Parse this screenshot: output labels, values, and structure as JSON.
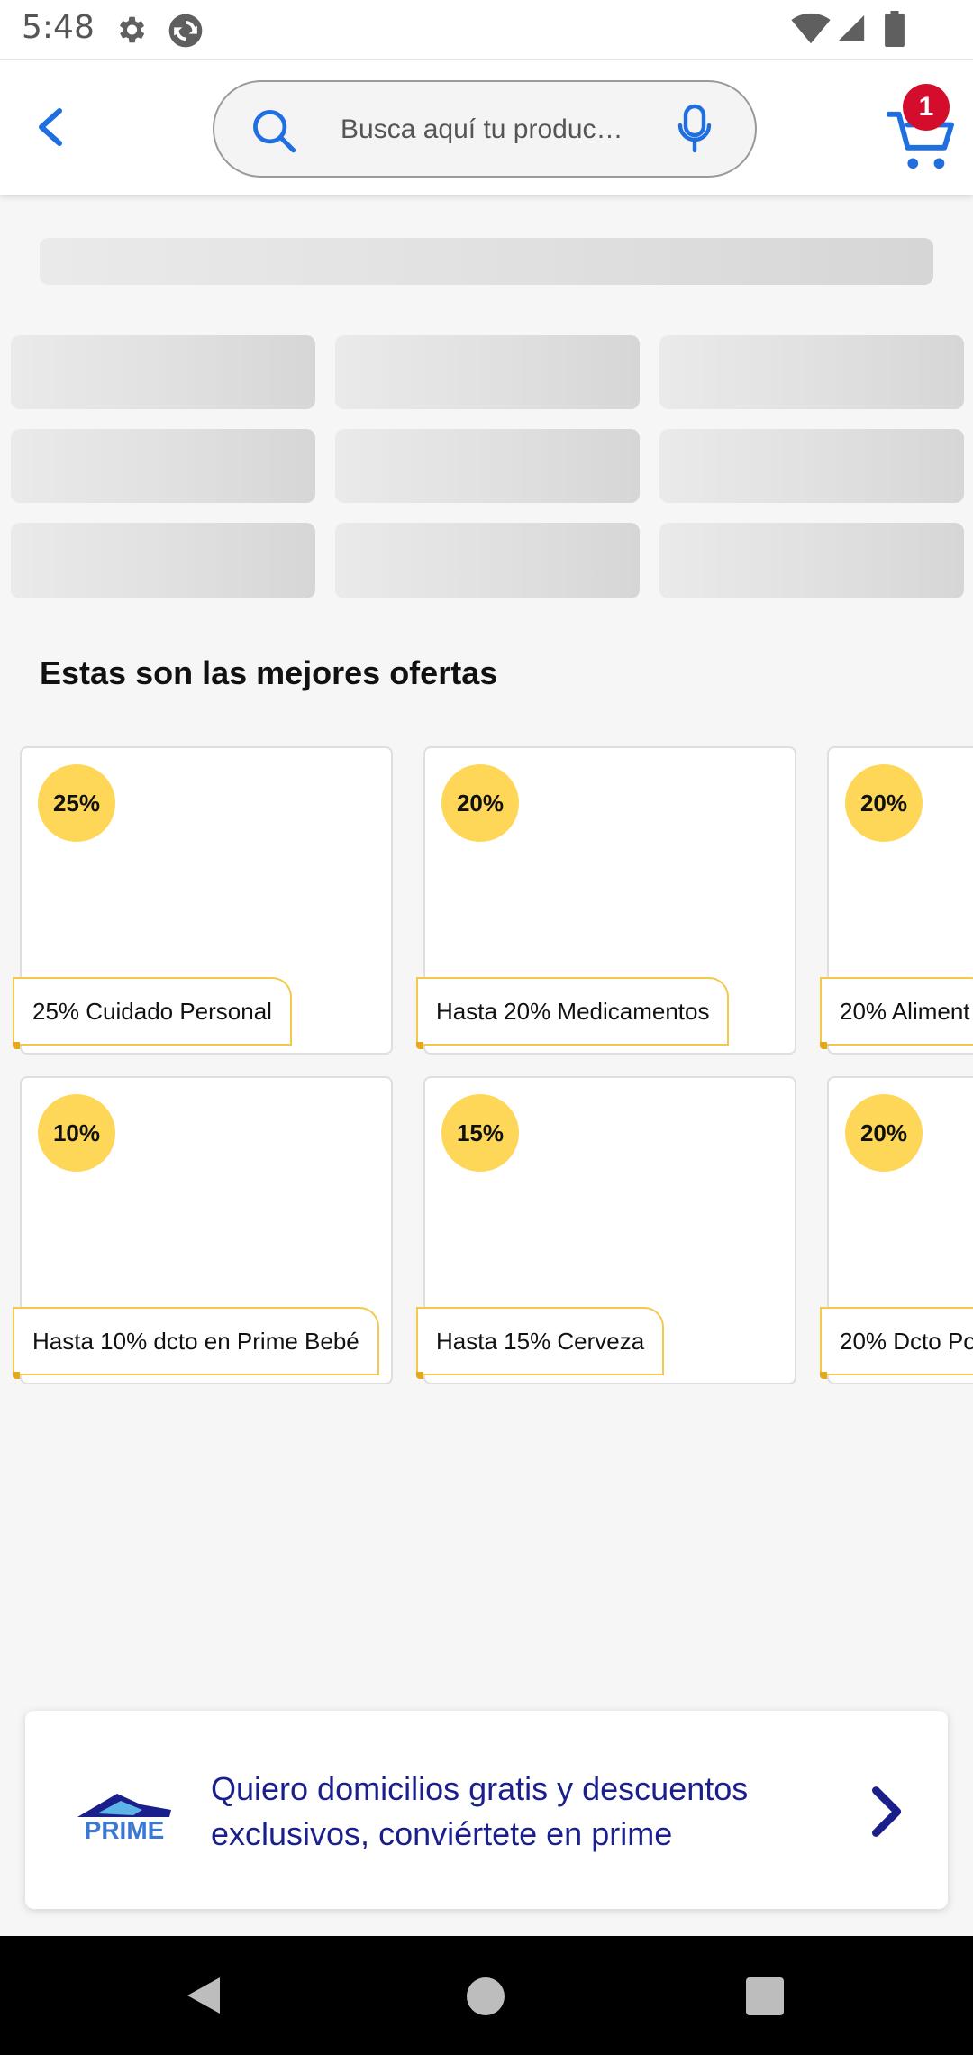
{
  "status_bar": {
    "time": "5:48",
    "icons": [
      "gear-icon",
      "sync-icon",
      "wifi-icon",
      "signal-icon",
      "battery-icon"
    ]
  },
  "header": {
    "back_icon": "chevron-left-icon",
    "search": {
      "placeholder": "Busca aquí tu produc…",
      "icon": "search-icon",
      "mic_icon": "microphone-icon"
    },
    "cart": {
      "icon": "cart-icon",
      "badge_count": "1"
    }
  },
  "colors": {
    "accent_blue": "#1f6fe0",
    "badge_red": "#d40d2c",
    "discount_yellow": "#fed758",
    "tag_border": "#f4c84a",
    "prime_navy": "#1a1f8c",
    "background": "#f6f6f6"
  },
  "offers": {
    "title": "Estas son las mejores ofertas",
    "items": [
      {
        "discount": "25%",
        "label": "25% Cuidado Personal"
      },
      {
        "discount": "20%",
        "label": "Hasta 20% Medicamentos"
      },
      {
        "discount": "20%",
        "label": "20% Aliment"
      },
      {
        "discount": "10%",
        "label": "Hasta 10% dcto en Prime Bebé"
      },
      {
        "discount": "15%",
        "label": "Hasta 15% Cerveza"
      },
      {
        "discount": "20%",
        "label": "20% Dcto Po"
      }
    ]
  },
  "prime_banner": {
    "logo_text": "PRIME",
    "text_line1": "Quiero domicilios gratis y descuentos",
    "text_line2": "exclusivos, conviértete en prime",
    "chevron_icon": "chevron-right-icon"
  },
  "nav_bar": {
    "buttons": [
      "back-triangle-icon",
      "home-circle-icon",
      "recents-square-icon"
    ]
  }
}
